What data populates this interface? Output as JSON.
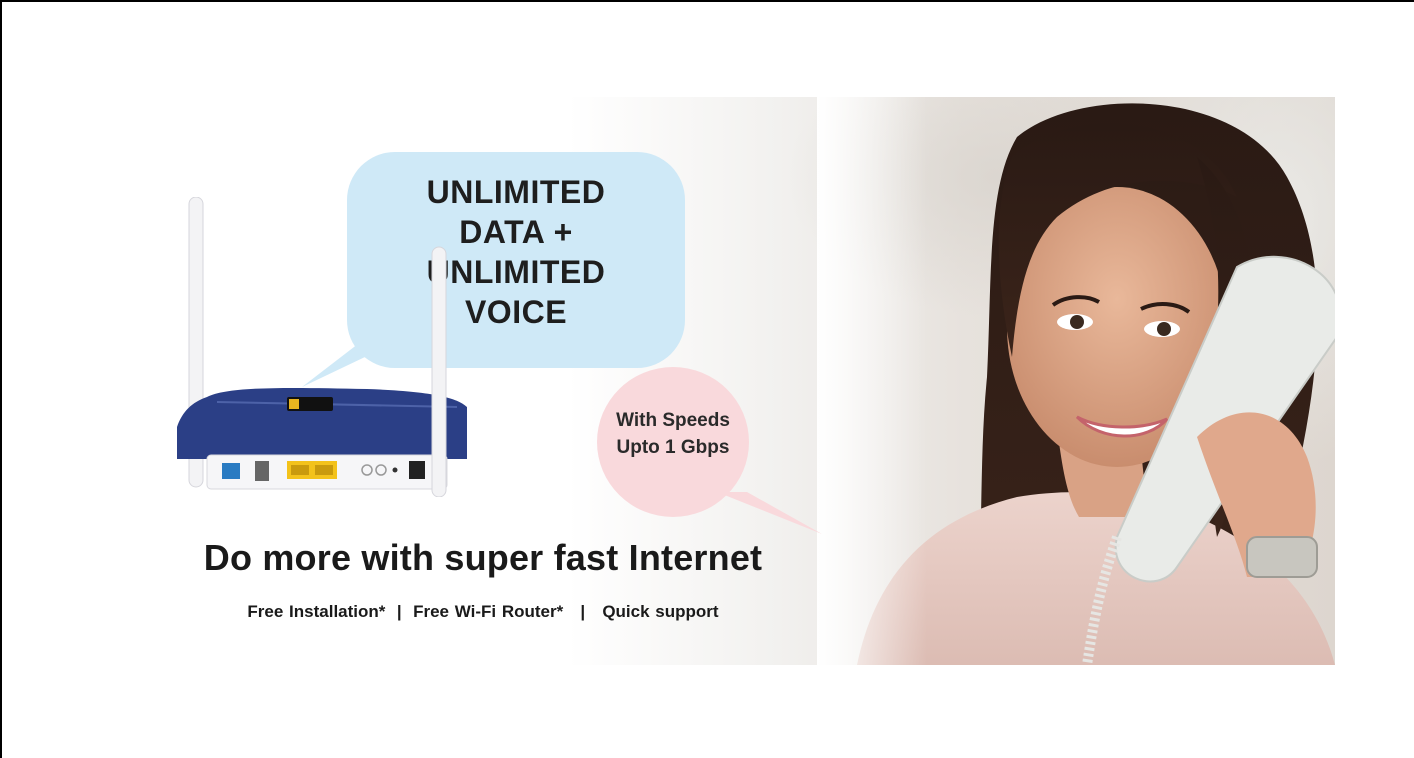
{
  "bubble": {
    "lines": [
      "UNLIMITED",
      "DATA +",
      "UNLIMITED",
      "VOICE"
    ]
  },
  "speed_bubble": {
    "line1": "With Speeds",
    "line2": "Upto 1 Gbps"
  },
  "headline": "Do more with super fast Internet",
  "features": [
    "Free Installation*",
    "Free Wi-Fi Router*",
    "Quick support"
  ],
  "separator": "|",
  "colors": {
    "blue_bubble": "#cfe9f7",
    "pink_bubble": "#f9d9dc",
    "router_blue": "#2b3f86",
    "port_yellow": "#f3c21b"
  },
  "images": {
    "router": "wifi-router-icon",
    "person": "woman-on-phone"
  }
}
